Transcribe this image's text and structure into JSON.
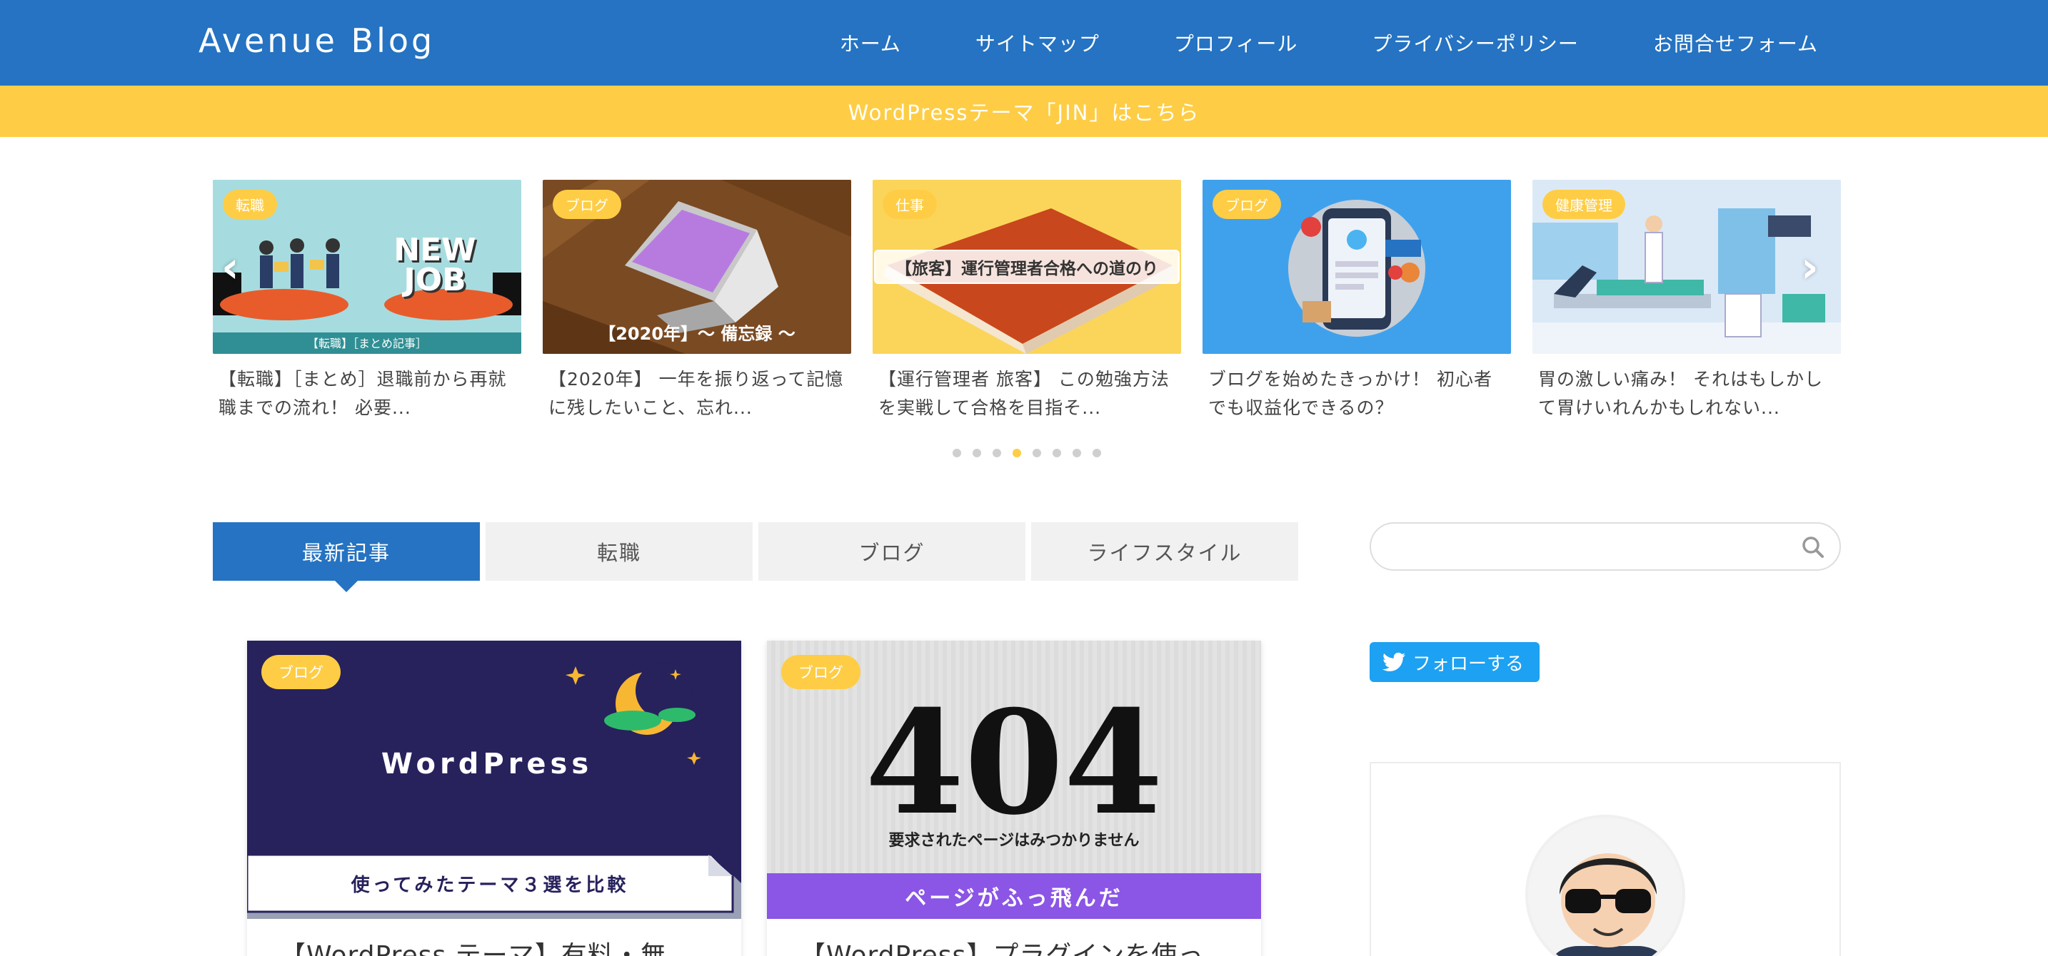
{
  "header": {
    "site_title": "Avenue Blog",
    "nav": [
      "ホーム",
      "サイトマップ",
      "プロフィール",
      "プライバシーポリシー",
      "お問合せフォーム"
    ]
  },
  "notice": {
    "text": "WordPressテーマ「JIN」はこちら"
  },
  "slider": {
    "slides": [
      {
        "category": "転職",
        "title_line1": "【転職】［まとめ］退職前から再就",
        "title_line2": "職までの流れ！ 必要...",
        "img_text": "NEW JOB",
        "img_sub": "【転職】［まとめ記事］"
      },
      {
        "category": "ブログ",
        "title_line1": "【2020年】 一年を振り返って記憶",
        "title_line2": "に残したいこと、忘れ...",
        "img_text": "【2020年】～ 備忘録 ～"
      },
      {
        "category": "仕事",
        "title_line1": "【運行管理者 旅客】 この勉強方法",
        "title_line2": "を実戦して合格を目指そ...",
        "img_text": "【旅客】運行管理者合格への道のり"
      },
      {
        "category": "ブログ",
        "title_line1": "ブログを始めたきっかけ！ 初心者",
        "title_line2": "でも収益化できるの？"
      },
      {
        "category": "健康管理",
        "title_line1": "胃の激しい痛み！ それはもしかし",
        "title_line2": "て胃けいれんかもしれない..."
      }
    ],
    "prev_icon": "‹",
    "next_icon": "›",
    "dot_count": 8,
    "active_dot": 3
  },
  "tabs": [
    {
      "label": "最新記事",
      "active": true
    },
    {
      "label": "転職",
      "active": false
    },
    {
      "label": "ブログ",
      "active": false
    },
    {
      "label": "ライフスタイル",
      "active": false
    }
  ],
  "cards": [
    {
      "category": "ブログ",
      "img_title": "WordPress",
      "img_banner": "使ってみたテーマ３選を比較",
      "title": "【WordPress テーマ】有料・無..."
    },
    {
      "category": "ブログ",
      "img_title": "404",
      "img_sub": "要求されたページはみつかりません",
      "img_banner": "ページがふっ飛んだ",
      "title": "【WordPress】プラグインを使っ..."
    }
  ],
  "sidebar": {
    "search_placeholder": "",
    "follow_label": "フォローする"
  },
  "colors": {
    "primary": "#2573c2",
    "accent": "#fecd45",
    "twitter": "#1da1f2"
  }
}
